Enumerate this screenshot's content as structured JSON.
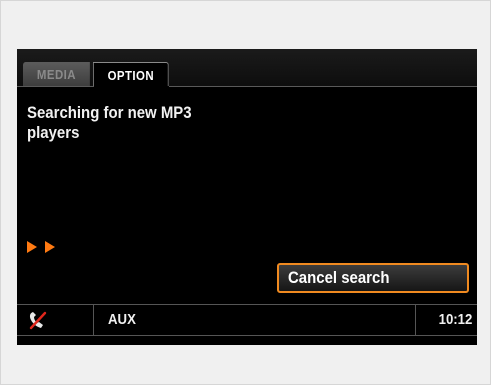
{
  "tabs": {
    "media_label": "MEDIA",
    "option_label": "OPTION"
  },
  "main": {
    "message_line1": "Searching for new MP3",
    "message_line2": "players",
    "cancel_label": "Cancel search"
  },
  "status": {
    "source_label": "AUX",
    "clock": "10:12",
    "phone_icon": "phone-crossed-icon"
  },
  "colors": {
    "accent": "#f08a20",
    "arrow": "#ff7a12",
    "background": "#000000"
  }
}
